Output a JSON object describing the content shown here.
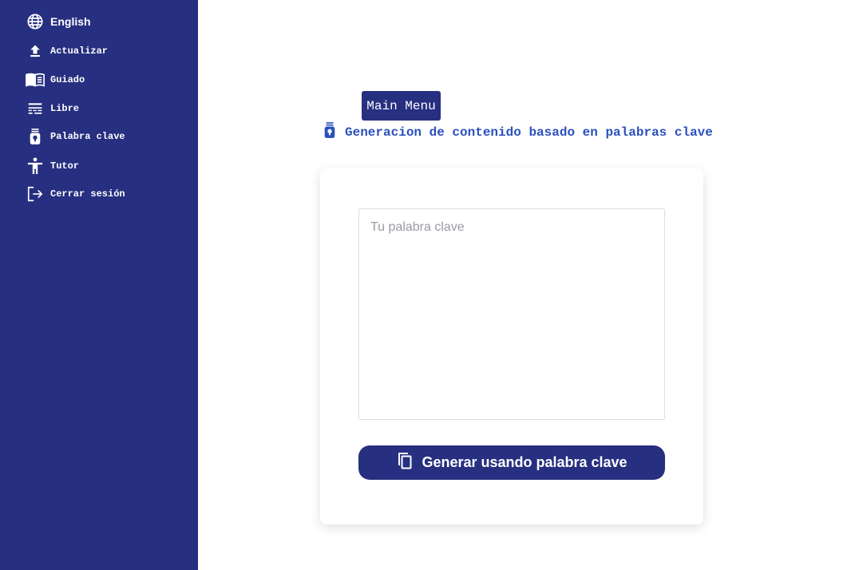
{
  "sidebar": {
    "items": [
      {
        "label": "English",
        "icon": "globe-icon"
      },
      {
        "label": "Actualizar",
        "icon": "upload-icon"
      },
      {
        "label": "Guiado",
        "icon": "book-icon"
      },
      {
        "label": "Libre",
        "icon": "text-lines-icon"
      },
      {
        "label": "Palabra clave",
        "icon": "key-tag-icon"
      },
      {
        "label": "Tutor",
        "icon": "person-icon"
      },
      {
        "label": "Cerrar sesión",
        "icon": "logout-icon"
      }
    ]
  },
  "main": {
    "menu_button": "Main Menu",
    "subtitle": "Generacion de contenido basado en palabras clave",
    "keyword_placeholder": "Tu palabra clave",
    "keyword_value": "",
    "generate_button": "Generar usando palabra clave"
  },
  "colors": {
    "sidebar_bg": "#272f80",
    "accent": "#272f80",
    "subtitle_text": "#2c50bd"
  }
}
